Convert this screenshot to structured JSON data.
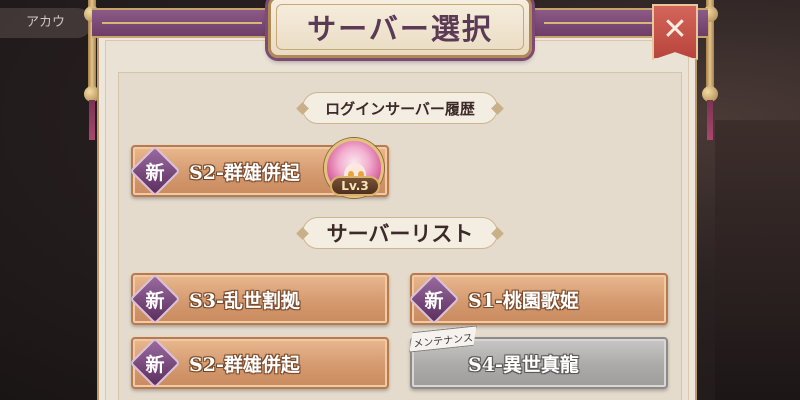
{
  "account": {
    "label": "アカウ"
  },
  "header": {
    "title": "サーバー選択",
    "close_icon": "close-icon"
  },
  "history": {
    "section_label": "ログインサーバー履歴",
    "servers": [
      {
        "badge": "新",
        "name": "S2-群雄併起",
        "level": "Lv.3"
      }
    ]
  },
  "server_list": {
    "section_label": "サーバーリスト",
    "servers": [
      {
        "badge": "新",
        "name": "S3-乱世割拠",
        "status": "new"
      },
      {
        "badge": "新",
        "name": "S1-桃園歌姫",
        "status": "new"
      },
      {
        "badge": "新",
        "name": "S2-群雄併起",
        "status": "new"
      },
      {
        "tag": "メンテナンス",
        "name": "S4-異世真龍",
        "status": "maintenance"
      }
    ]
  },
  "colors": {
    "accent_purple": "#6d3c67",
    "button_copper": "#d59a6f",
    "maintenance_gray": "#acaaa8",
    "close_red": "#c4524a"
  }
}
